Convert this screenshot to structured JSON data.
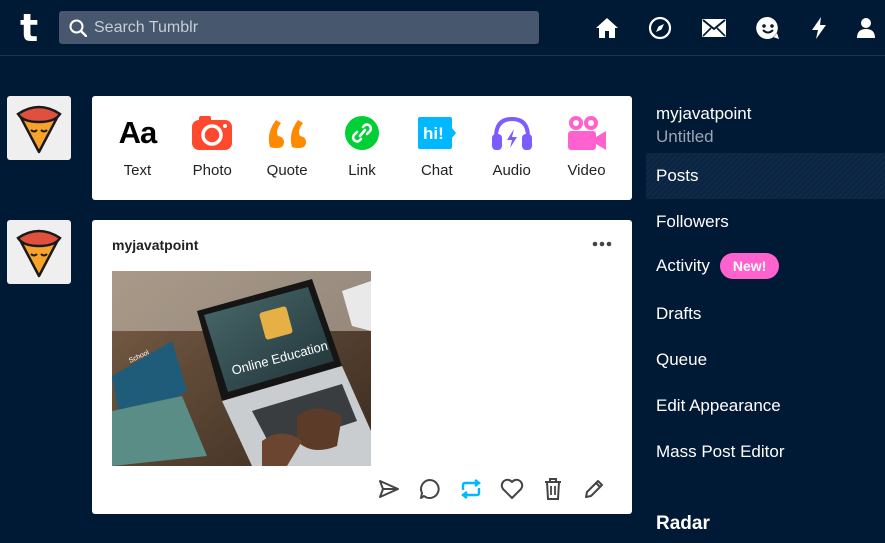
{
  "header": {
    "logo": "t",
    "search_placeholder": "Search Tumblr",
    "icons": [
      "home-icon",
      "explore-icon",
      "inbox-icon",
      "messaging-icon",
      "activity-icon",
      "account-icon"
    ]
  },
  "composer": {
    "types": [
      {
        "label": "Text",
        "icon": "text-icon",
        "color": "#000000"
      },
      {
        "label": "Photo",
        "icon": "camera-icon",
        "color": "#ff492f"
      },
      {
        "label": "Quote",
        "icon": "quote-icon",
        "color": "#ff8a00"
      },
      {
        "label": "Link",
        "icon": "link-icon",
        "color": "#00cf35"
      },
      {
        "label": "Chat",
        "icon": "chat-icon",
        "color": "#00b8ff"
      },
      {
        "label": "Audio",
        "icon": "headphones-icon",
        "color": "#7c5cff"
      },
      {
        "label": "Video",
        "icon": "video-camera-icon",
        "color": "#ff62ce"
      }
    ]
  },
  "post": {
    "author": "myjavatpoint",
    "image_caption": "Online Education",
    "book_label": "School",
    "actions": [
      "share-icon",
      "reply-icon",
      "reblog-icon",
      "like-icon",
      "delete-icon",
      "edit-icon"
    ]
  },
  "sidebar": {
    "blog_name": "myjavatpoint",
    "blog_title": "Untitled",
    "items": [
      {
        "label": "Posts",
        "active": true
      },
      {
        "label": "Followers"
      },
      {
        "label": "Activity",
        "badge": "New!"
      },
      {
        "label": "Drafts"
      },
      {
        "label": "Queue"
      },
      {
        "label": "Edit Appearance"
      },
      {
        "label": "Mass Post Editor"
      }
    ],
    "section_title": "Radar"
  },
  "colors": {
    "background": "#001935",
    "accent_pink": "#ff62ce",
    "reblog_blue": "#00b8ff"
  }
}
